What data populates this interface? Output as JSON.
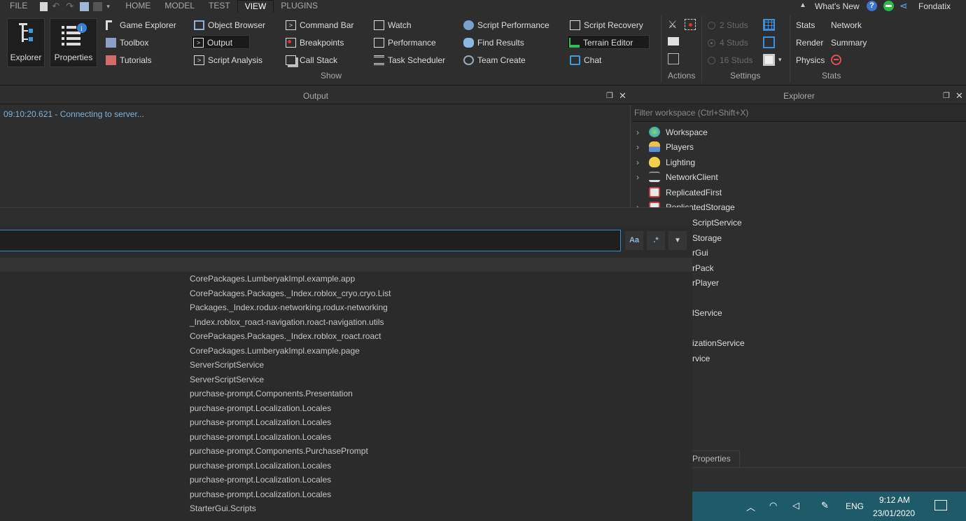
{
  "menubar": {
    "file": "FILE",
    "tabs": [
      "HOME",
      "MODEL",
      "TEST",
      "VIEW",
      "PLUGINS"
    ],
    "active_tab": "VIEW",
    "whats_new": "What's New",
    "username": "Fondatix"
  },
  "ribbon": {
    "explorer_label": "Explorer",
    "properties_label": "Properties",
    "col1": [
      "Game Explorer",
      "Toolbox",
      "Tutorials"
    ],
    "col2": [
      "Object Browser",
      "Output",
      "Script Analysis"
    ],
    "col3": [
      "Command Bar",
      "Breakpoints",
      "Call Stack"
    ],
    "col4": [
      "Watch",
      "Performance",
      "Task Scheduler"
    ],
    "col5": [
      "Script Performance",
      "Find Results",
      "Team Create"
    ],
    "col6": [
      "Script Recovery",
      "Terrain Editor",
      "Chat"
    ],
    "show_group": "Show",
    "actions_group": "Actions",
    "settings_group": "Settings",
    "studs": [
      "2 Studs",
      "4 Studs",
      "16 Studs"
    ],
    "stats_items": [
      "Stats",
      "Network",
      "Render",
      "Summary",
      "Physics"
    ],
    "stats_group": "Stats"
  },
  "output": {
    "title": "Output",
    "line": "09:10:20.621 - Connecting to server..."
  },
  "explorer": {
    "title": "Explorer",
    "filter_placeholder": "Filter workspace (Ctrl+Shift+X)",
    "items": [
      "Workspace",
      "Players",
      "Lighting",
      "NetworkClient",
      "ReplicatedFirst",
      "ReplicatedStorage"
    ],
    "fragments": [
      "ScriptService",
      "Storage",
      "rGui",
      "rPack",
      "rPlayer",
      "lService",
      "izationService",
      "rvice"
    ],
    "properties_tab": "Properties"
  },
  "find": {
    "value": "",
    "match_case": "Aa",
    "regex": ".*",
    "results": [
      "CorePackages.LumberyakImpl.example.app",
      "CorePackages.Packages._Index.roblox_cryo.cryo.List",
      "Packages._Index.rodux-networking.rodux-networking",
      "_Index.roblox_roact-navigation.roact-navigation.utils",
      "CorePackages.Packages._Index.roblox_roact.roact",
      "CorePackages.LumberyakImpl.example.page",
      "ServerScriptService",
      "ServerScriptService",
      "purchase-prompt.Components.Presentation",
      "purchase-prompt.Localization.Locales",
      "purchase-prompt.Localization.Locales",
      "purchase-prompt.Localization.Locales",
      "purchase-prompt.Components.PurchasePrompt",
      "purchase-prompt.Localization.Locales",
      "purchase-prompt.Localization.Locales",
      "purchase-prompt.Localization.Locales",
      "StarterGui.Scripts"
    ]
  },
  "taskbar": {
    "lang": "ENG",
    "time": "9:12 AM",
    "date": "23/01/2020"
  }
}
